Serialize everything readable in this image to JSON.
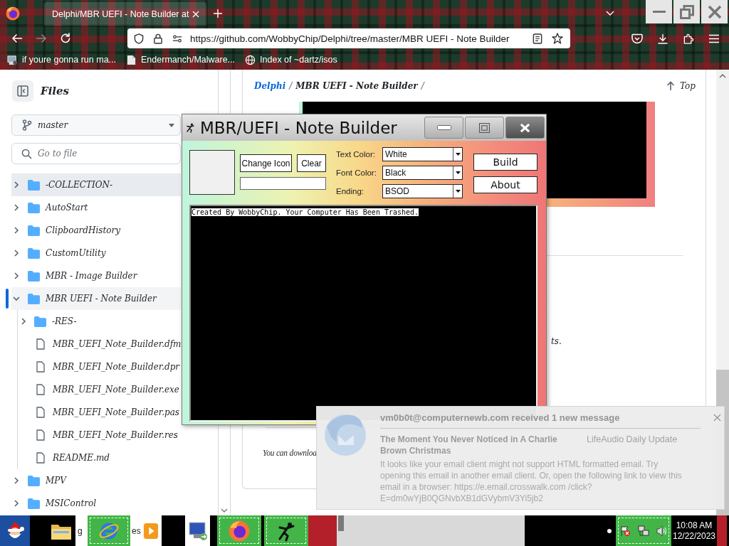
{
  "browser": {
    "tabs": [
      {
        "title": "Delphi/MBR UEFI - Note Builder at",
        "selected": true
      }
    ],
    "nav": [
      {
        "kind": "back",
        "disabled": false
      },
      {
        "kind": "forward",
        "disabled": true
      },
      {
        "kind": "reload",
        "disabled": false
      }
    ],
    "url": "https://github.com/WobbyChip/Delphi/tree/master/MBR UEFI - Note Builder",
    "bookmarks": [
      {
        "kind": "app",
        "label": "if youre gonna run ma..."
      },
      {
        "kind": "page",
        "label": "Endermanch/Malware..."
      },
      {
        "kind": "globe",
        "label": "Index of ~dartz/isos"
      }
    ]
  },
  "sidebar": {
    "title": "Files",
    "branch": "master",
    "search": {
      "placeholder": "Go to file"
    },
    "tree": [
      {
        "name": "-COLLECTION-",
        "kind": "folder",
        "expanded": false,
        "selected": false,
        "hovered": true
      },
      {
        "name": "AutoStart",
        "kind": "folder",
        "expanded": false,
        "selected": false,
        "hovered": false
      },
      {
        "name": "ClipboardHistory",
        "kind": "folder",
        "expanded": false,
        "selected": false,
        "hovered": false
      },
      {
        "name": "CustomUtility",
        "kind": "folder",
        "expanded": false,
        "selected": false,
        "hovered": false
      },
      {
        "name": "MBR - Image Builder",
        "kind": "folder",
        "expanded": false,
        "selected": false,
        "hovered": false
      },
      {
        "name": "MBR UEFI - Note Builder",
        "kind": "folder",
        "expanded": true,
        "selected": true,
        "hovered": false,
        "children": [
          {
            "name": "-RES-",
            "kind": "folder",
            "expanded": false,
            "selected": false,
            "hovered": false
          },
          {
            "name": "MBR_UEFI_Note_Builder.dfm",
            "kind": "file",
            "selected": false,
            "hovered": false
          },
          {
            "name": "MBR_UEFI_Note_Builder.dpr",
            "kind": "file",
            "selected": false,
            "hovered": false
          },
          {
            "name": "MBR_UEFI_Note_Builder.exe",
            "kind": "file",
            "selected": false,
            "hovered": false
          },
          {
            "name": "MBR_UEFI_Note_Builder.pas",
            "kind": "file",
            "selected": false,
            "hovered": false
          },
          {
            "name": "MBR_UEFI_Note_Builder.res",
            "kind": "file",
            "selected": false,
            "hovered": false
          },
          {
            "name": "README.md",
            "kind": "file",
            "selected": false,
            "hovered": false
          }
        ]
      },
      {
        "name": "MPV",
        "kind": "folder",
        "expanded": false,
        "selected": false,
        "hovered": false
      },
      {
        "name": "MSIControl",
        "kind": "folder",
        "expanded": false,
        "selected": false,
        "hovered": false
      }
    ]
  },
  "main": {
    "breadcrumb": [
      {
        "label": "Delphi",
        "kind": "link"
      },
      {
        "label": "/",
        "kind": "separator"
      },
      {
        "label": "MBR UEFI - Note Builder",
        "kind": "current"
      },
      {
        "label": "/",
        "kind": "separator"
      }
    ],
    "top_link": "Top",
    "fragments": [
      "ts.",
      "You can downloa"
    ]
  },
  "dialog": {
    "title": "MBR/UEFI - Note Builder",
    "icon_buttons": [
      "Change Icon",
      "Clear"
    ],
    "settings": [
      {
        "label": "Text Color:",
        "value": "White"
      },
      {
        "label": "Font Color:",
        "value": "Black"
      },
      {
        "label": "Ending:",
        "value": "BSOD"
      }
    ],
    "actions": [
      "Build",
      "About"
    ],
    "preview_text": "Created By WobbyChip. Your Computer Has Been Trashed."
  },
  "notification": {
    "title": "vm0b0t@computernewb.com received 1 new message",
    "subject": "The Moment You Never Noticed in A Charlie Brown Christmas",
    "sender": "LifeAudio Daily Update",
    "preview": "It looks like your email client might not support HTML formatted email. Try opening this email in another email client. Or, open the following link to view this email in a browser: https://e.email.crosswalk.com /click?E=dm0wYjB0QGNvbXB1dGVybmV3Yi5jb2"
  },
  "taskbar": {
    "labels": [
      "g",
      "es"
    ],
    "time": "10:08 AM",
    "date": "12/22/2023"
  }
}
